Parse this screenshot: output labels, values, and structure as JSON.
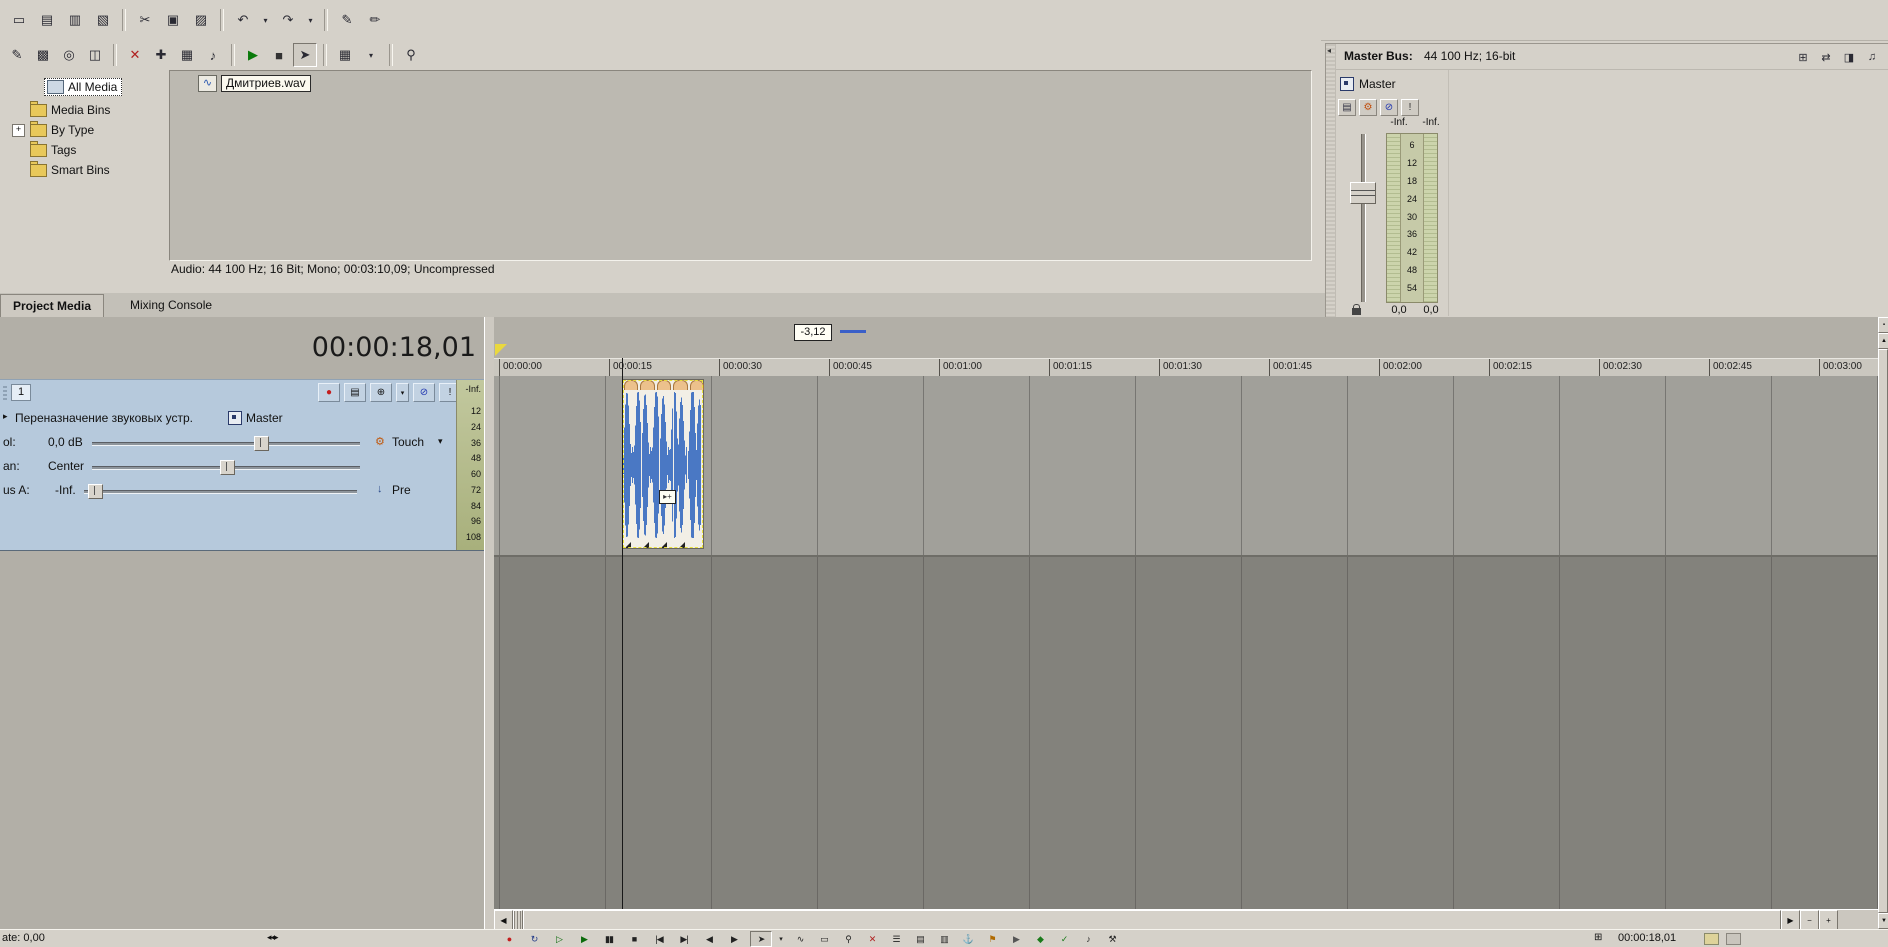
{
  "toolbar_main": {
    "items": [
      {
        "name": "new-project-button",
        "glyph": "▭"
      },
      {
        "name": "open-project-button",
        "glyph": "▤"
      },
      {
        "name": "save-project-button",
        "glyph": "▥"
      },
      {
        "name": "project-properties-button",
        "glyph": "▧"
      },
      {
        "sep": true
      },
      {
        "name": "cut-button",
        "glyph": "✂"
      },
      {
        "name": "copy-button",
        "glyph": "▣"
      },
      {
        "name": "paste-button",
        "glyph": "▨"
      },
      {
        "sep": true
      },
      {
        "name": "undo-button",
        "glyph": "↶"
      },
      {
        "name": "undo-dropdown",
        "glyph": "▾",
        "narrow": true
      },
      {
        "name": "redo-button",
        "glyph": "↷"
      },
      {
        "name": "redo-dropdown",
        "glyph": "▾",
        "narrow": true
      },
      {
        "sep": true
      },
      {
        "name": "normal-edit-tool-button",
        "glyph": "✎"
      },
      {
        "name": "envelope-edit-tool-button",
        "glyph": "✏"
      }
    ]
  },
  "toolbar_media": {
    "items": [
      {
        "name": "import-media-button",
        "glyph": "✎"
      },
      {
        "name": "capture-video-button",
        "glyph": "▩"
      },
      {
        "name": "extract-audio-cd-button",
        "glyph": "◎"
      },
      {
        "name": "get-media-web-button",
        "glyph": "◫"
      },
      {
        "sep": true
      },
      {
        "name": "remove-media-button",
        "glyph": "✕",
        "color": "#b02020"
      },
      {
        "name": "media-properties-button",
        "glyph": "✚"
      },
      {
        "name": "media-fx-button",
        "glyph": "▦"
      },
      {
        "name": "media-bin-button",
        "glyph": "♪"
      },
      {
        "sep": true
      },
      {
        "name": "preview-play-button",
        "glyph": "▶",
        "color": "#0a7a0a"
      },
      {
        "name": "preview-stop-button",
        "glyph": "■",
        "color": "#333333"
      },
      {
        "name": "auto-preview-button",
        "glyph": "➤",
        "pressed": true
      },
      {
        "sep": true
      },
      {
        "name": "views-button",
        "glyph": "▦"
      },
      {
        "name": "views-dropdown",
        "glyph": "▾",
        "narrow": true
      },
      {
        "sep": true
      },
      {
        "name": "search-media-button",
        "glyph": "⚲"
      }
    ]
  },
  "media_tree": {
    "expand_glyph": "+",
    "items": [
      {
        "label": "All Media"
      },
      {
        "label": "Media Bins"
      },
      {
        "label": "By Type"
      },
      {
        "label": "Tags"
      },
      {
        "label": "Smart Bins"
      }
    ]
  },
  "media_pane": {
    "file_label": "Дмитриев.wav",
    "status": "Audio: 44 100 Hz; 16 Bit; Mono; 00:03:10,09; Uncompressed"
  },
  "tabs": {
    "project_media": "Project Media",
    "mixing_console": "Mixing Console"
  },
  "master_bus": {
    "collapse_icon": "◂",
    "title": "Master Bus:",
    "subtitle": "44 100 Hz; 16-bit",
    "header_icons": [
      {
        "name": "insert-bus-button",
        "glyph": "⊞"
      },
      {
        "name": "io-routing-button",
        "glyph": "⇄"
      },
      {
        "name": "mixer-view-button",
        "glyph": "◨"
      },
      {
        "name": "downmix-output-button",
        "glyph": "♫"
      }
    ],
    "channel": {
      "label": "Master",
      "icons": [
        {
          "name": "routing-icon",
          "glyph": "▤",
          "color": "#333344"
        },
        {
          "name": "bus-fx-button",
          "glyph": "⚙",
          "color": "#c05010"
        },
        {
          "name": "mute-button",
          "glyph": "⊘",
          "color": "#2036b0"
        },
        {
          "name": "solo-button",
          "glyph": "!",
          "color": "#333333"
        }
      ],
      "peak_left": "-Inf.",
      "peak_right": "-Inf.",
      "scale": [
        "6",
        "12",
        "18",
        "24",
        "30",
        "36",
        "42",
        "48",
        "54"
      ],
      "rms_left": "0,0",
      "rms_right": "0,0"
    }
  },
  "timeline": {
    "timecode": "00:00:18,01",
    "marker_tooltip": "-3,12",
    "ruler_ticks": [
      "00:00:00",
      "00:00:15",
      "00:00:30",
      "00:00:45",
      "00:01:00",
      "00:01:15",
      "00:01:30",
      "00:01:45",
      "00:02:00",
      "00:02:15",
      "00:02:30",
      "00:02:45",
      "00:03:00"
    ]
  },
  "track": {
    "number": "1",
    "buttons": [
      {
        "name": "arm-record-button",
        "glyph": "●",
        "color": "#c41e1e"
      },
      {
        "name": "track-meter-button",
        "glyph": "▤"
      },
      {
        "name": "insert-fx-button",
        "glyph": "⊕"
      },
      {
        "name": "insert-fx-dropdown",
        "glyph": "▾",
        "narrow": true
      },
      {
        "name": "mute-button",
        "glyph": "⊘",
        "color": "#2036b0"
      },
      {
        "name": "solo-button",
        "glyph": "!"
      }
    ],
    "expander_glyph": "▸",
    "device_label": "Переназначение звуковых устр.",
    "bus_label": "Master",
    "vol_label": "ol:",
    "vol_value": "0,0 dB",
    "gear_glyph": "⚙",
    "automation_mode": "Touch",
    "automation_dropdown": "▾",
    "pan_label": "an:",
    "pan_value": "Center",
    "bus_send_label": "us A:",
    "bus_send_value": "-Inf.",
    "pre_icon": "↓",
    "pre_label": "Pre",
    "meter_top": "-Inf.",
    "meter_scale": [
      "12",
      "24",
      "36",
      "48",
      "60",
      "72",
      "84",
      "96",
      "108"
    ]
  },
  "transport": {
    "buttons": [
      {
        "name": "record-button",
        "glyph": "●",
        "color": "#c41e1e"
      },
      {
        "name": "loop-playback-button",
        "glyph": "↻",
        "color": "#223a88"
      },
      {
        "name": "play-from-start-button",
        "glyph": "▷",
        "color": "#0a6a0a"
      },
      {
        "name": "play-button",
        "glyph": "▶",
        "color": "#0a6a0a"
      },
      {
        "name": "pause-button",
        "glyph": "▮▮"
      },
      {
        "name": "stop-button",
        "glyph": "■"
      },
      {
        "name": "go-to-start-button",
        "glyph": "|◀"
      },
      {
        "name": "go-to-end-button",
        "glyph": "▶|"
      },
      {
        "name": "prev-frame-button",
        "glyph": "◀"
      },
      {
        "name": "next-frame-button",
        "glyph": "▶"
      }
    ]
  },
  "tools": {
    "buttons": [
      {
        "name": "edit-tool-button",
        "glyph": "➤",
        "pressed": true
      },
      {
        "name": "edit-tool-dropdown",
        "glyph": "▾",
        "narrow": true
      },
      {
        "name": "envelope-tool-button",
        "glyph": "∿"
      },
      {
        "name": "selection-tool-button",
        "glyph": "▭"
      },
      {
        "name": "zoom-tool-button",
        "glyph": "⚲"
      },
      {
        "name": "delete-button",
        "glyph": "✕",
        "color": "#b02020"
      },
      {
        "name": "trim-button",
        "glyph": "☰"
      },
      {
        "name": "split-button",
        "glyph": "▤"
      },
      {
        "name": "group-button",
        "glyph": "▥"
      },
      {
        "name": "lock-event-button",
        "glyph": "⚓"
      },
      {
        "name": "ignore-grouping-button",
        "glyph": "⚑",
        "color": "#b06a00"
      },
      {
        "name": "auto-ripple-button",
        "glyph": "▶",
        "color": "#555555"
      },
      {
        "name": "envelope-edit-button",
        "glyph": "◆",
        "color": "#1a7a1a"
      },
      {
        "name": "automation-button",
        "glyph": "✓",
        "color": "#1a7a1a"
      },
      {
        "name": "metronome-button",
        "glyph": "♪"
      },
      {
        "name": "script-button",
        "glyph": "⚒"
      }
    ]
  },
  "scrollbars": {
    "h_left": "◀",
    "h_right": "▶",
    "zoom_out": "−",
    "zoom_in": "+",
    "v_top": "▪",
    "v_up": "▲",
    "v_down": "▼"
  },
  "statusbar": {
    "rate": "ate: 0,00",
    "spinner": "◂◂▸",
    "snap_glyph": "⊞",
    "timecode": "00:00:18,01"
  }
}
